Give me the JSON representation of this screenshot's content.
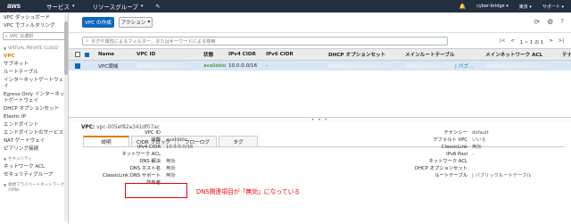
{
  "nav": {
    "logo": "aws",
    "services": "サービス",
    "resource_groups": "リソースグループ",
    "account": "cyber-bridge",
    "region": "東京",
    "support": "サポート"
  },
  "sidebar": {
    "dashboard": "VPC ダッシュボード",
    "filter_by_vpc": "VPC でフィルタリング",
    "vpc_select_placeholder": "VPC の選択",
    "section_vpc": "VIRTUAL PRIVATE CLOUD",
    "items": [
      "VPC",
      "サブネット",
      "ルートテーブル",
      "インターネットゲートウェイ",
      "Egress Only インターネットゲートウェイ",
      "DHCP オプションセット",
      "Elastic IP",
      "エンドポイント",
      "エンドポイントのサービス",
      "NAT ゲートウェイ",
      "ピアリング接続"
    ],
    "section_security": "セキュリティ",
    "security_items": [
      "ネットワーク ACL",
      "セキュリティグループ"
    ],
    "section_vpn": "仮想プライベートネットワーク (VPN)"
  },
  "toolbar": {
    "create_vpc": "VPC の作成",
    "actions": "アクション"
  },
  "filter": {
    "placeholder": "タグや属性によるフィルター、またはキーワードによる検索",
    "pager": "1 ~ 1 の 1"
  },
  "table": {
    "headers": [
      "Name",
      "VPC ID",
      "状態",
      "IPv4 CIDR",
      "IPv6 CIDR",
      "DHCP オプションセット",
      "メインルートテーブル",
      "メインネットワーク ACL",
      "テナ"
    ],
    "row": {
      "name": "VPC領域",
      "state": "available",
      "ipv4": "10.0.0.0/16",
      "ipv6": "-",
      "route_suffix": "| パブ..."
    }
  },
  "details": {
    "title_label": "VPC:",
    "title_id": "vpc-005ef82a341df07ac",
    "tabs": [
      "説明",
      "CIDR ブロック",
      "フローログ",
      "タグ"
    ],
    "left": [
      {
        "k": "VPC ID",
        "v": ""
      },
      {
        "k": "状態",
        "v": "available"
      },
      {
        "k": "IPv4 CIDR",
        "v": "10.0.0.0/16"
      },
      {
        "k": "ネットワーク ACL",
        "v": ""
      },
      {
        "k": "DNS 解決",
        "v": "無効"
      },
      {
        "k": "DNS ホスト名",
        "v": "無効"
      },
      {
        "k": "ClassicLink DNS サポート",
        "v": "無効"
      },
      {
        "k": "所有者",
        "v": ""
      }
    ],
    "right": [
      {
        "k": "テナンシー",
        "v": "default"
      },
      {
        "k": "デフォルト VPC",
        "v": "いいえ"
      },
      {
        "k": "ClassicLink",
        "v": "無効"
      },
      {
        "k": "IPv6 Pool",
        "v": "-"
      },
      {
        "k": "ネットワーク ACL",
        "v": ""
      },
      {
        "k": "DHCP オプションセット",
        "v": ""
      },
      {
        "k": "ルートテーブル",
        "v": "| パブリックルートテーブル"
      }
    ],
    "annotation": "DNS関連項目が「無効」になっている"
  }
}
